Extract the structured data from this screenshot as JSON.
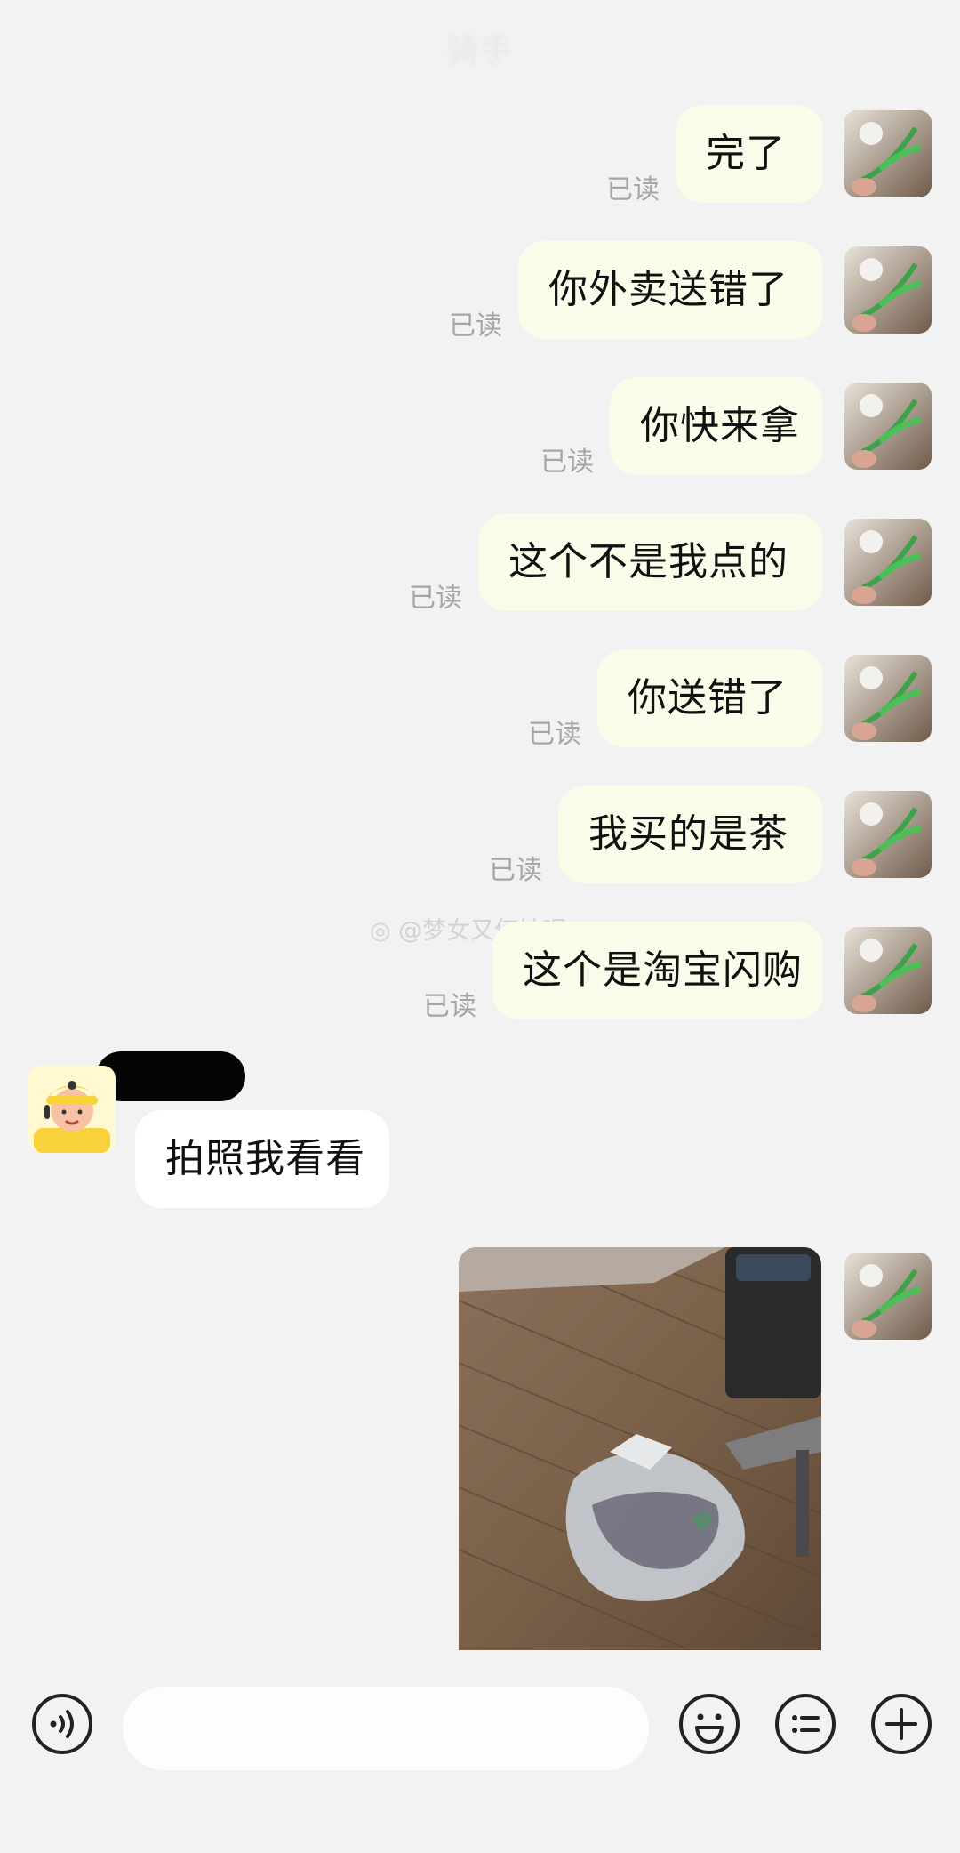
{
  "header": {
    "title": "骑手"
  },
  "messages": [
    {
      "side": "mine",
      "text": "完了",
      "status": "已读"
    },
    {
      "side": "mine",
      "text": "你外卖送错了",
      "status": "已读"
    },
    {
      "side": "mine",
      "text": "你快来拿",
      "status": "已读"
    },
    {
      "side": "mine",
      "text": "这个不是我点的",
      "status": "已读"
    },
    {
      "side": "mine",
      "text": "你送错了",
      "status": "已读"
    },
    {
      "side": "mine",
      "text": "我买的是茶",
      "status": "已读"
    },
    {
      "side": "mine",
      "text": "这个是淘宝闪购",
      "status": "已读"
    },
    {
      "side": "theirs",
      "text": "拍照我看看"
    },
    {
      "side": "mine",
      "type": "image",
      "description_icon": "photo-of-bag-on-floor"
    }
  ],
  "watermark": "@梦女又何妨呢",
  "input": {
    "placeholder": "",
    "voice_icon": "voice-icon",
    "emoji_icon": "emoji-icon",
    "quick_reply_icon": "list-icon",
    "more_icon": "plus-icon"
  },
  "colors": {
    "background": "#f2f2f2",
    "my_bubble": "#fafbe9",
    "their_bubble": "#ffffff",
    "read_status": "#a6a6a6"
  }
}
